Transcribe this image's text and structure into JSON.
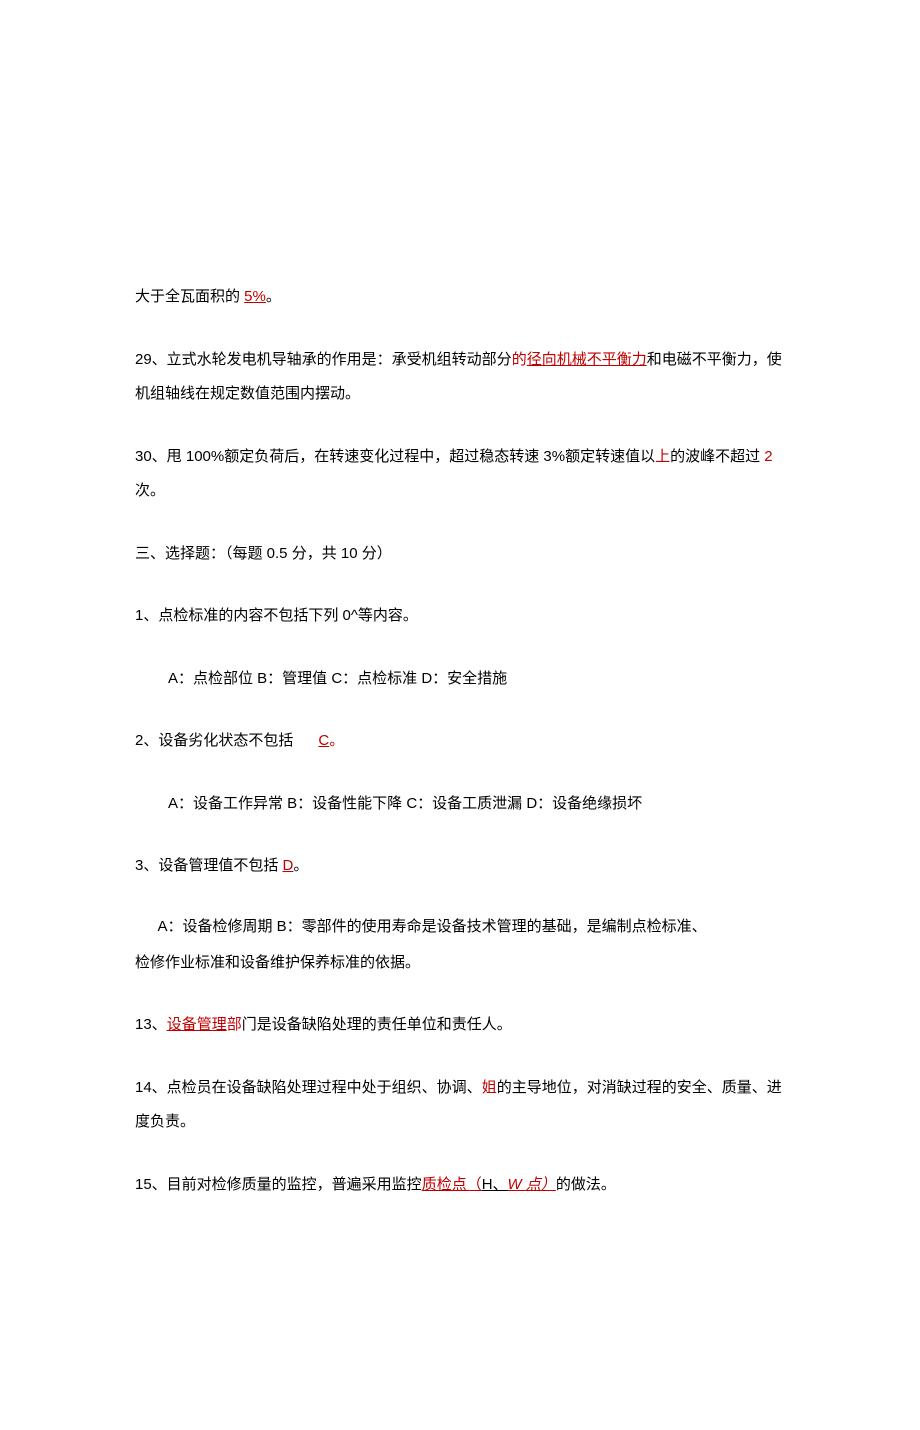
{
  "line28": {
    "t1": "大于全瓦面积的 ",
    "ans": "5%",
    "t2": "。"
  },
  "q29": {
    "t1": "29、立式水轮发电机导轴承的作用是：承受机组转动部分",
    "mid": "的",
    "ans": "径向机械不平衡力",
    "t2": "和电磁不平衡力，使机组轴线在规定数值范围内摆动。"
  },
  "q30": {
    "t1": "30、甩 100%额定负荷后，在转速变化过程中，超过稳态转速 3%额定转速值以",
    "mid": "上",
    "t2": "的波峰不超过 ",
    "ans": "2",
    "t3": " 次。"
  },
  "section3": "三、选择题：（每题 0.5 分，共 10 分）",
  "mc1": {
    "q": "1、点检标准的内容不包括下列 0^等内容。",
    "opts": "A：点检部位 B：管理值 C：点检标准 D：安全措施"
  },
  "mc2": {
    "q1": "2、设备劣化状态不包括",
    "ans": "C",
    "q2": "。",
    "opts": "A：设备工作异常 B：设备性能下降 C：设备工质泄漏 D：设备绝缘损坏"
  },
  "mc3": {
    "q1": "3、设备管理值不包括 ",
    "ans": "D",
    "q2": "。",
    "opt_l1": "A：设备检修周期 B：零部件的使用寿命是设备技术管理的基础，是编制点检标准、",
    "opt_l2": "检修作业标准和设备维护保养标准的依据。"
  },
  "q13": {
    "t1": "13、",
    "ans": "设备管理",
    "mid": "部",
    "t2": "门是设备缺陷处理的责任单位和责任人。"
  },
  "q14": {
    "t1": "14、点检员在设备缺陷处理过程中处于组织、协调、",
    "ans": "姐",
    "t2": "的主导地位，对消缺过程的安全、质量、进度负责。"
  },
  "q15": {
    "t1": "15、目前对检修质量的监控，普遍采用监控",
    "ans_a": "质检点（",
    "ans_b": "H、",
    "ans_c": "W 点）",
    "t2": "的做法。"
  }
}
